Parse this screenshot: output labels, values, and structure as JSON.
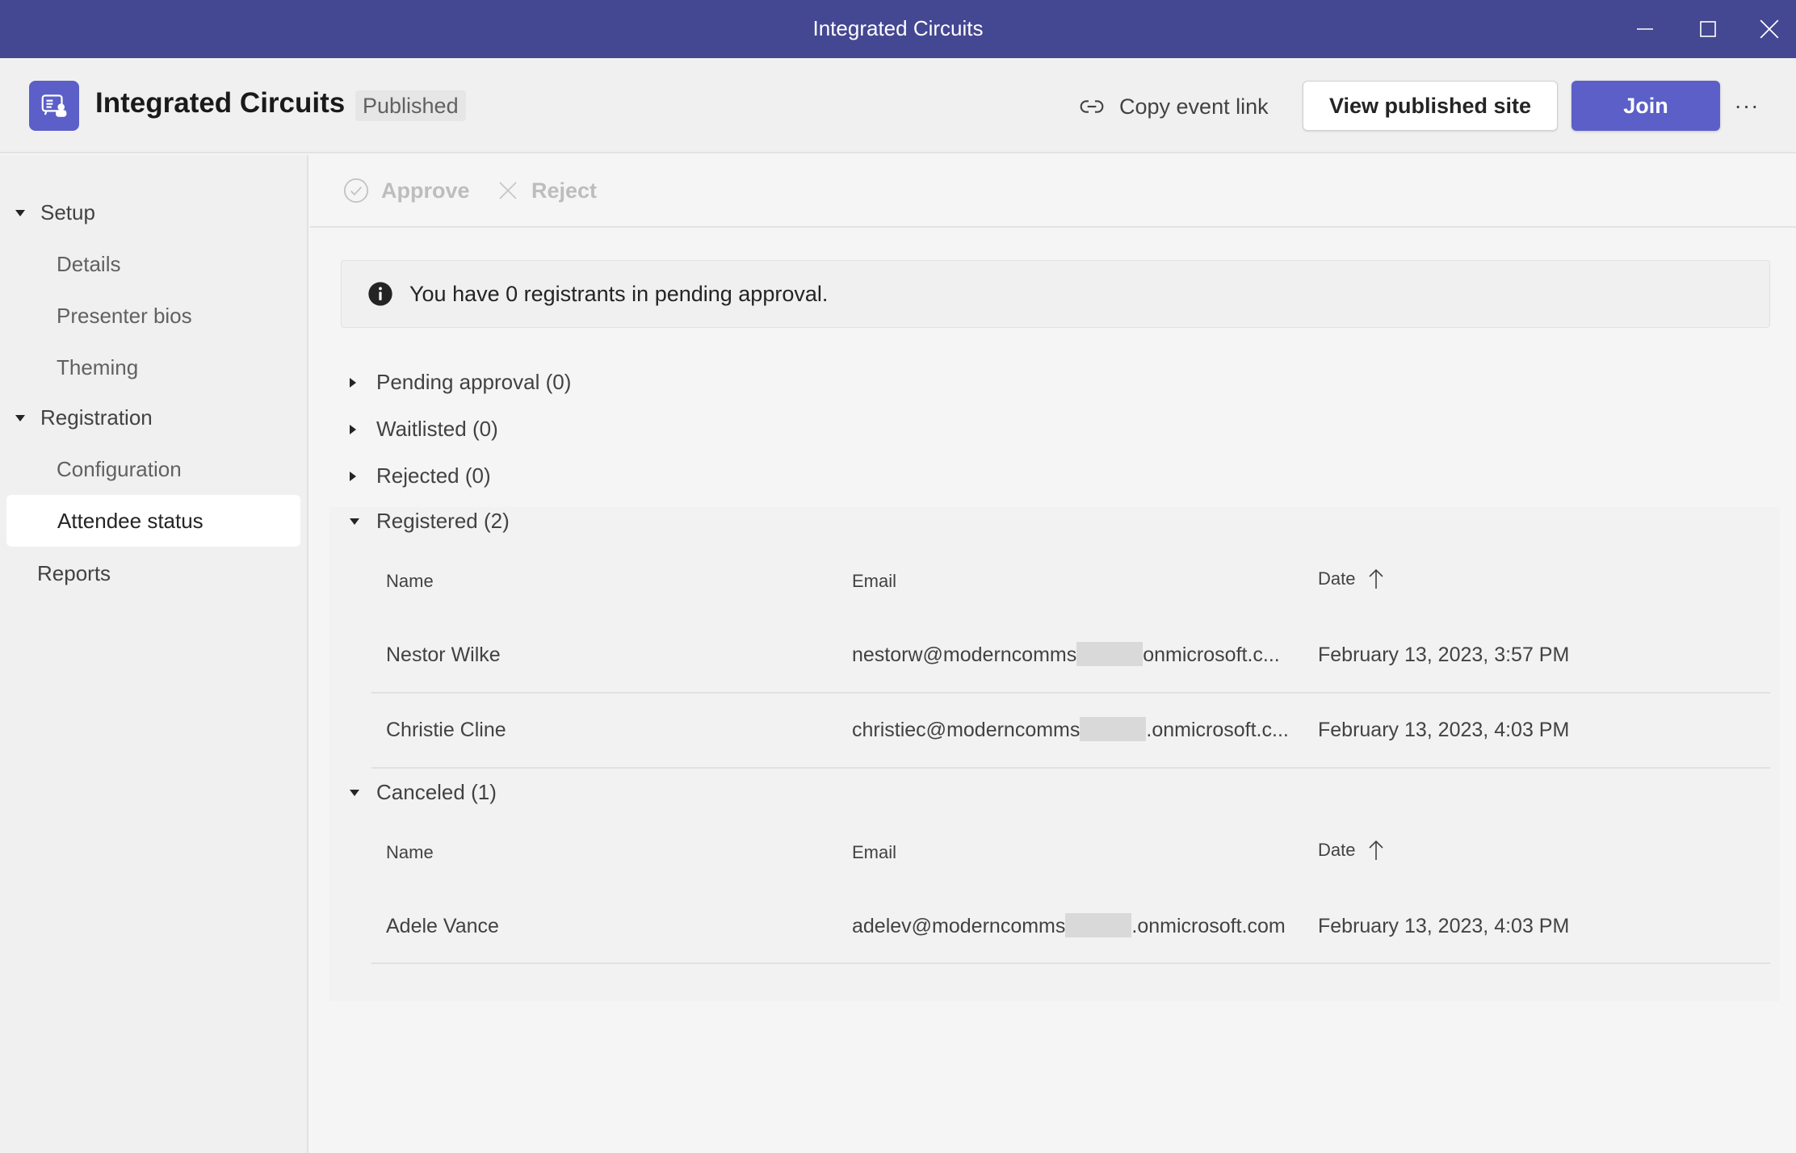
{
  "window": {
    "title": "Integrated Circuits",
    "controls": [
      "minimize",
      "maximize",
      "close"
    ]
  },
  "header": {
    "event_title": "Integrated Circuits",
    "status": "Published",
    "copy_link_label": "Copy event link",
    "view_site_label": "View published site",
    "join_label": "Join",
    "more_label": "···",
    "accent_color": "#5b5fc7",
    "titlebar_color": "#444791"
  },
  "sidebar": {
    "groups": [
      {
        "label": "Setup",
        "expanded": true,
        "items": [
          "Details",
          "Presenter bios",
          "Theming"
        ]
      },
      {
        "label": "Registration",
        "expanded": true,
        "items": [
          "Configuration",
          "Attendee status"
        ]
      }
    ],
    "standalone": [
      "Reports"
    ],
    "active_item": "Attendee status"
  },
  "toolbar": {
    "approve_label": "Approve",
    "reject_label": "Reject"
  },
  "banner": {
    "message": "You have 0 registrants in pending approval."
  },
  "sections": {
    "pending": {
      "label": "Pending approval (0)",
      "expanded": false
    },
    "waitlisted": {
      "label": "Waitlisted (0)",
      "expanded": false
    },
    "rejected": {
      "label": "Rejected (0)",
      "expanded": false
    },
    "registered": {
      "label": "Registered (2)",
      "expanded": true,
      "columns": [
        "Name",
        "Email",
        "Date"
      ],
      "sort": "Date ascending",
      "rows": [
        {
          "name": "Nestor Wilke",
          "email_prefix": "nestorw@moderncomms",
          "email_suffix": "onmicrosoft.c...",
          "date": "February 13, 2023, 3:57 PM"
        },
        {
          "name": "Christie Cline",
          "email_prefix": "christiec@moderncomms",
          "email_suffix": ".onmicrosoft.c...",
          "date": "February 13, 2023, 4:03 PM"
        }
      ]
    },
    "canceled": {
      "label": "Canceled (1)",
      "expanded": true,
      "columns": [
        "Name",
        "Email",
        "Date"
      ],
      "sort": "Date ascending",
      "rows": [
        {
          "name": "Adele Vance",
          "email_prefix": "adelev@moderncomms",
          "email_suffix": ".onmicrosoft.com",
          "date": "February 13, 2023, 4:03 PM"
        }
      ]
    }
  }
}
